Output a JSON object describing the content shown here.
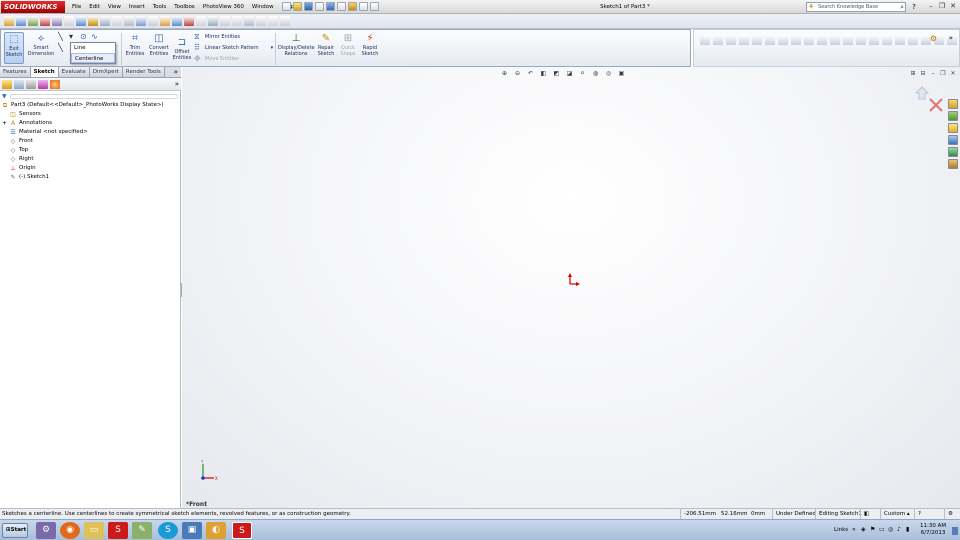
{
  "app": {
    "logo": "SOLIDWORKS",
    "document_title": "Sketch1 of Part3 *"
  },
  "menu": [
    "File",
    "Edit",
    "View",
    "Insert",
    "Tools",
    "Toolbox",
    "PhotoView 360",
    "Window",
    "Help"
  ],
  "search": {
    "placeholder": "Search Knowledge Base"
  },
  "command_manager": {
    "exit_sketch": "Exit Sketch",
    "smart_dimension": "Smart Dimension",
    "trim_entities": "Trim Entities",
    "convert_entities": "Convert Entities",
    "offset_entities": "Offset Entities",
    "mirror_entities": "Mirror Entities",
    "linear_sketch_pattern": "Linear Sketch Pattern",
    "move_entities": "Move Entities",
    "display_delete_relations": "Display/Delete Relations",
    "repair_sketch": "Repair Sketch",
    "quick_snaps": "Quick Snaps",
    "rapid_sketch": "Rapid Sketch"
  },
  "line_dropdown": {
    "items": [
      "Line",
      "Centerline"
    ],
    "highlighted": "Centerline"
  },
  "panel_tabs": [
    "Features",
    "Sketch",
    "Evaluate",
    "DimXpert",
    "Render Tools"
  ],
  "active_tab": "Sketch",
  "feature_tree": [
    {
      "label": "Part3  (Default<<Default>_PhotoWorks Display State>)",
      "icon": "part-icon"
    },
    {
      "label": "Sensors",
      "icon": "sensors-icon"
    },
    {
      "label": "Annotations",
      "icon": "annotations-icon",
      "expander": "+"
    },
    {
      "label": "Material <not specified>",
      "icon": "material-icon"
    },
    {
      "label": "Front",
      "icon": "plane-icon"
    },
    {
      "label": "Top",
      "icon": "plane-icon"
    },
    {
      "label": "Right",
      "icon": "plane-icon"
    },
    {
      "label": "Origin",
      "icon": "origin-icon"
    },
    {
      "label": "(-) Sketch1",
      "icon": "sketch-icon"
    }
  ],
  "viewport": {
    "view_name": "*Front",
    "triad_x": "X",
    "triad_y": "Y"
  },
  "status_bar": {
    "message": "Sketches a centerline. Use centerlines to create symmetrical sketch elements, revolved features, or as construction geometry.",
    "x": "-206.51mm",
    "y": "52.16mm",
    "z": "0mm",
    "definition": "Under Defined",
    "editing": "Editing Sketch1",
    "units": "Custom"
  },
  "taskbar": {
    "start": "Start",
    "links": "Links",
    "time": "11:30 AM",
    "date": "6/7/2013"
  },
  "colors": {
    "accent": "#cc0000",
    "origin_red": "#d40000",
    "triad_green": "#1a9a1a",
    "triad_blue": "#1a3ad4"
  }
}
